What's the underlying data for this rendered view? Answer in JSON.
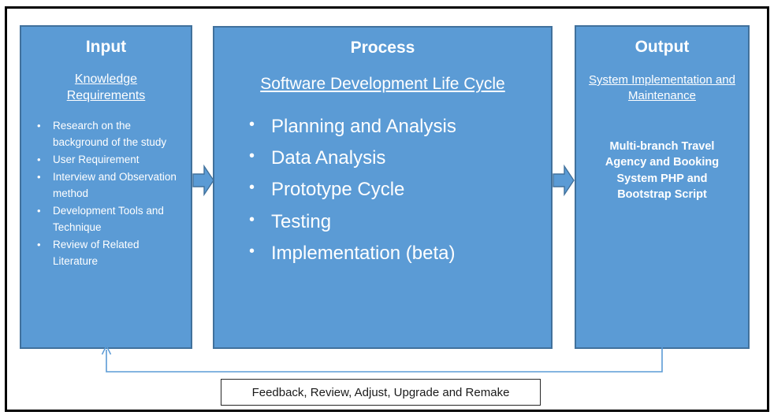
{
  "diagram": {
    "colors": {
      "box_fill": "#5B9BD5",
      "box_border": "#41719C",
      "text_on_box": "#FFFFFF",
      "frame": "#000000",
      "feedback_line": "#5B9BD5",
      "feedback_box_border": "#262626"
    },
    "input": {
      "title": "Input",
      "subtitle": "Knowledge Requirements",
      "bullets": [
        "Research on the background of the study",
        "User Requirement",
        "Interview and Observation method",
        "Development Tools and Technique",
        "Review of Related Literature"
      ]
    },
    "process": {
      "title": "Process",
      "subtitle": "Software Development Life Cycle",
      "bullets": [
        "Planning and Analysis",
        "Data Analysis",
        "Prototype Cycle",
        "Testing",
        "Implementation (beta)"
      ]
    },
    "output": {
      "title": "Output",
      "subtitle": "System Implementation and Maintenance",
      "statement": "Multi-branch Travel Agency and Booking System PHP and Bootstrap Script"
    },
    "feedback": {
      "label": "Feedback, Review, Adjust, Upgrade and Remake"
    },
    "arrows": {
      "input_to_process": "right-block-arrow",
      "process_to_output": "right-block-arrow",
      "feedback_loop": "output-to-input-return-arrow"
    }
  }
}
